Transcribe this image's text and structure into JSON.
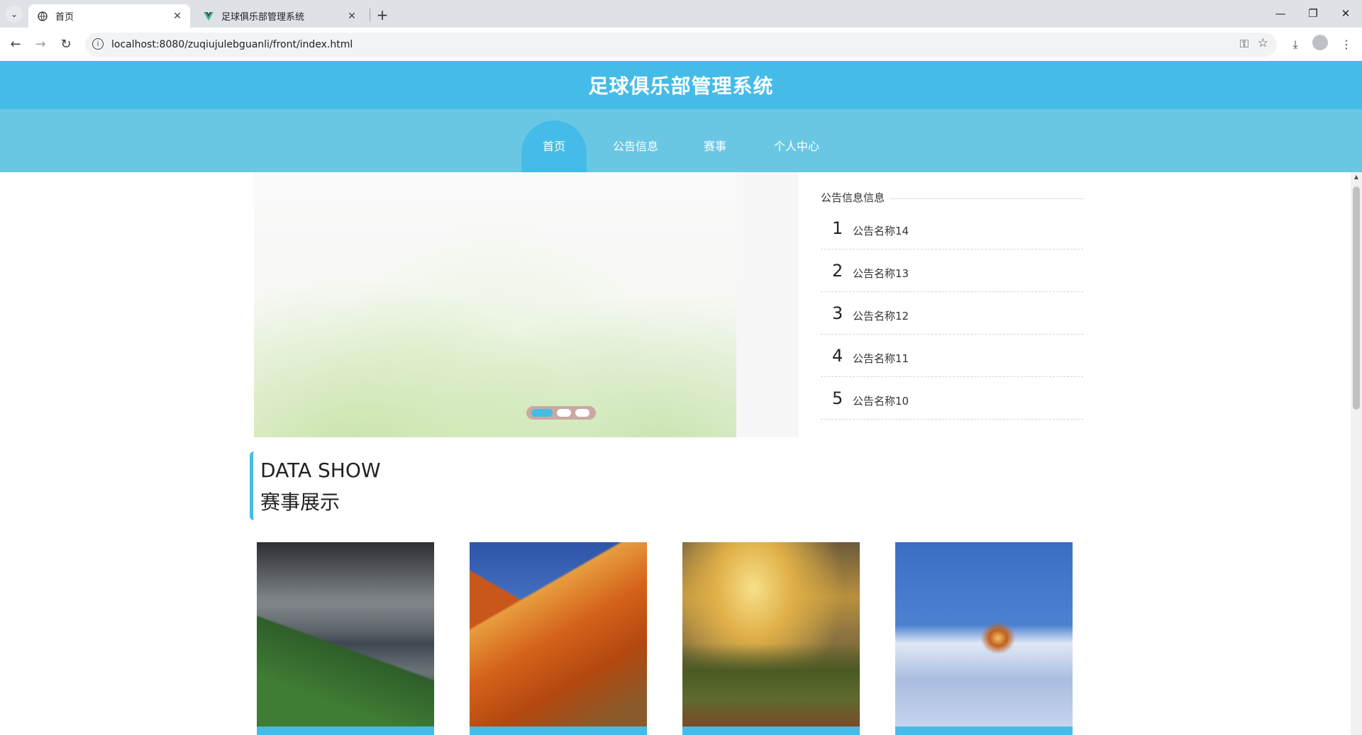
{
  "browser": {
    "tabs": [
      {
        "title": "首页",
        "active": true,
        "icon": "globe-icon"
      },
      {
        "title": "足球俱乐部管理系统",
        "active": false,
        "icon": "vue-logo-icon"
      }
    ],
    "new_tab_label": "+",
    "url": "localhost:8080/zuqiujulebguanli/front/index.html"
  },
  "site": {
    "title": "足球俱乐部管理系统",
    "nav": [
      {
        "label": "首页",
        "active": true
      },
      {
        "label": "公告信息",
        "active": false
      },
      {
        "label": "赛事",
        "active": false
      },
      {
        "label": "个人中心",
        "active": false
      }
    ]
  },
  "carousel": {
    "slide_count": 3,
    "active_index": 0
  },
  "notice": {
    "heading": "公告信息信息",
    "items": [
      {
        "num": "1",
        "name": "公告名称14"
      },
      {
        "num": "2",
        "name": "公告名称13"
      },
      {
        "num": "3",
        "name": "公告名称12"
      },
      {
        "num": "4",
        "name": "公告名称11"
      },
      {
        "num": "5",
        "name": "公告名称10"
      }
    ]
  },
  "section": {
    "title_en": "DATA SHOW",
    "title_cn": "赛事展示"
  },
  "cards": [
    {
      "image": "lake-village-photo"
    },
    {
      "image": "orange-mountain-photo"
    },
    {
      "image": "mountain-valley-sunset-photo"
    },
    {
      "image": "snow-cabin-photo"
    }
  ],
  "colors": {
    "primary": "#45bce7",
    "nav_bg": "#6ac7e4"
  }
}
